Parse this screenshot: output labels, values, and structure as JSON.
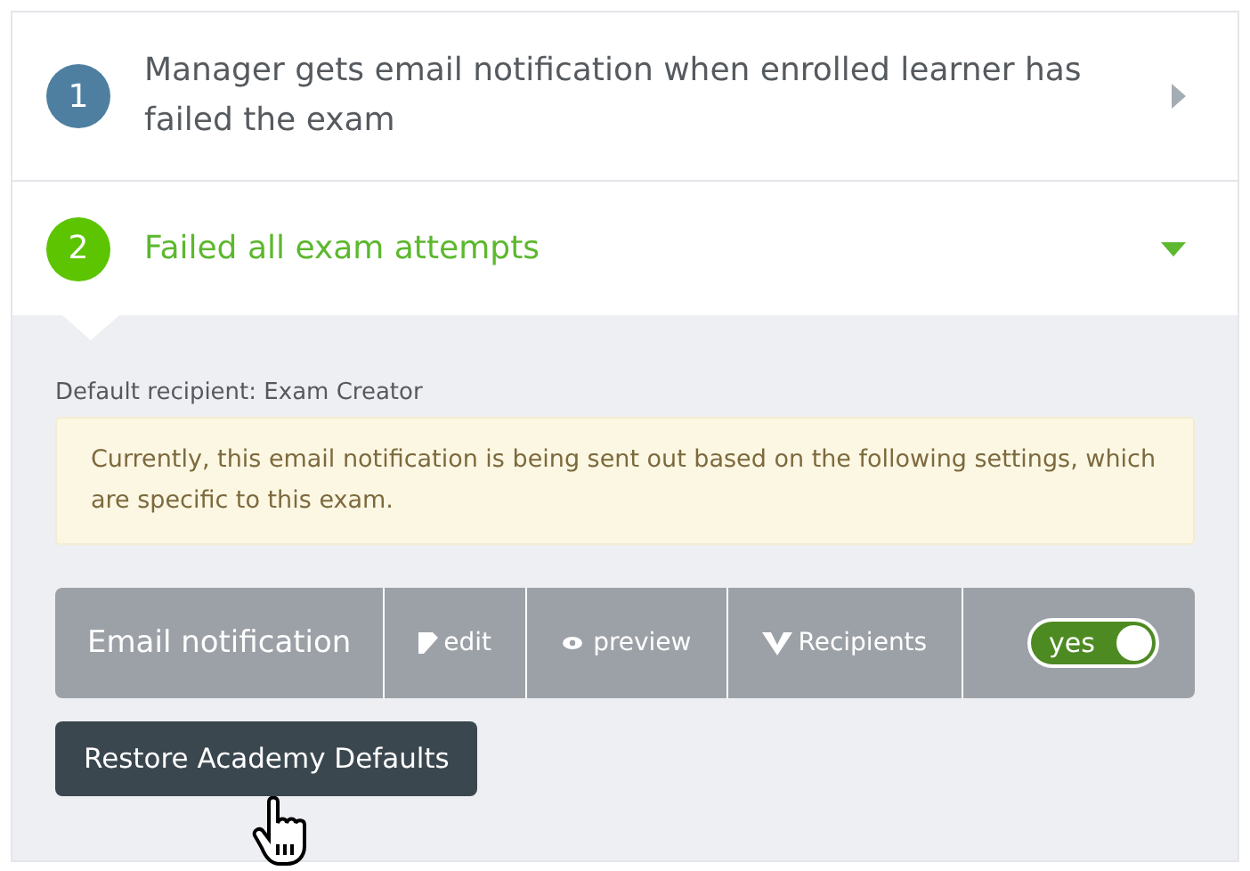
{
  "steps": [
    {
      "number": "1",
      "title": "Manager gets email notification when enrolled learner has failed the exam",
      "expanded": false
    },
    {
      "number": "2",
      "title": "Failed all exam attempts",
      "expanded": true
    }
  ],
  "panel": {
    "default_recipient": "Default recipient: Exam Creator",
    "notice": "Currently, this email notification is being sent out based on the following settings, which are specific to this exam.",
    "toolbar": {
      "label": "Email notification",
      "actions": [
        {
          "kind": "edit",
          "label": "edit"
        },
        {
          "kind": "preview",
          "label": "preview"
        },
        {
          "kind": "recipients",
          "label": "Recipients"
        }
      ],
      "toggle": {
        "label": "yes",
        "on": true
      }
    },
    "restore_button": "Restore Academy Defaults"
  }
}
